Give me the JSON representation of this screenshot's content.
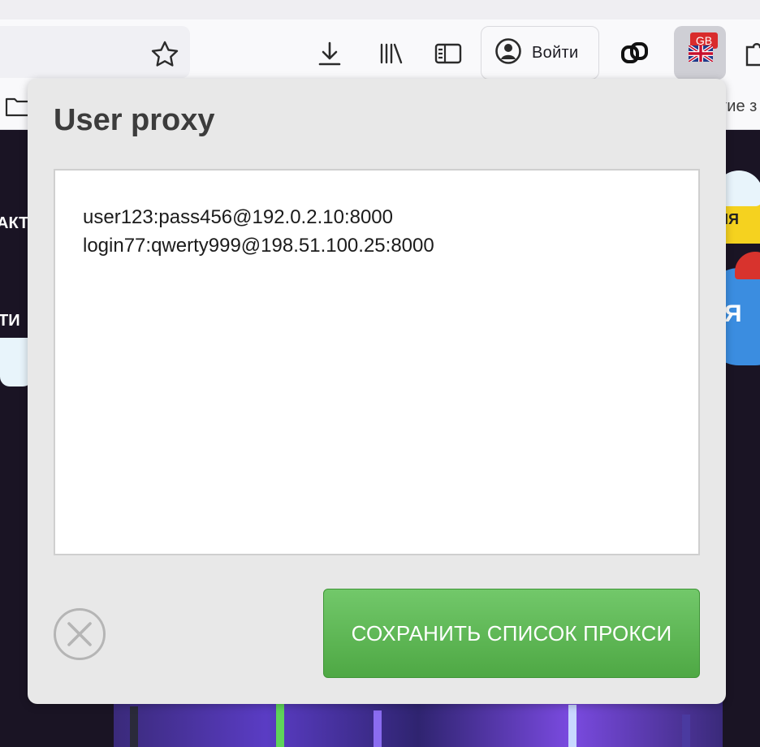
{
  "toolbar": {
    "login_label": "Войти",
    "badge_text": "GB"
  },
  "bookmarks": {
    "right_partial_text": "гие з"
  },
  "page_bg": {
    "left_text_1": "АКТ",
    "left_text_2": "ТИ",
    "right_pill_text": "ЯЯ",
    "right_blob_text": "Я"
  },
  "popup": {
    "title": "User proxy",
    "proxy_lines": [
      "user123:pass456@192.0.2.10:8000",
      "login77:qwerty999@198.51.100.25:8000"
    ],
    "save_label": "СОХРАНИТЬ СПИСОК ПРОКСИ"
  },
  "colors": {
    "save_button": "#5db653",
    "popup_bg": "#e8e8e8",
    "badge_red": "#d92c2c",
    "page_dark": "#1a1424"
  },
  "icons": [
    "star-icon",
    "download-icon",
    "library-icon",
    "sidebar-icon",
    "account-icon",
    "link-extension-icon",
    "uk-flag-icon",
    "puzzle-icon",
    "folder-icon",
    "close-icon"
  ]
}
